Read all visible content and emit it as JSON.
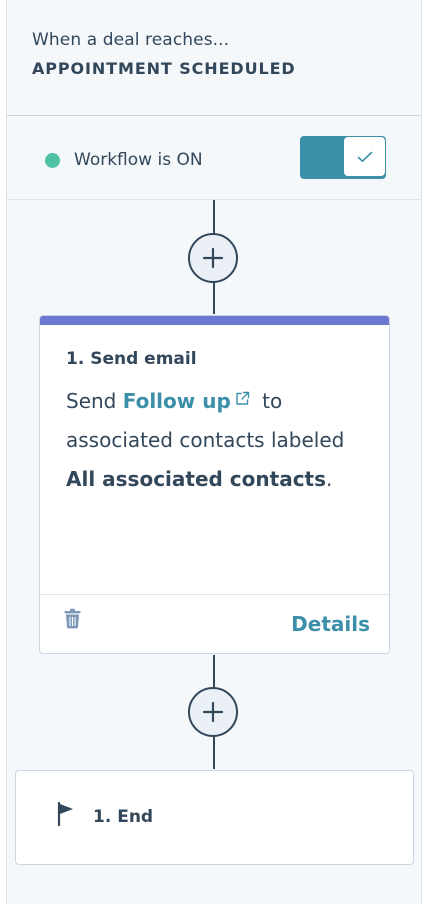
{
  "trigger": {
    "label": "When a deal reaches...",
    "stage": "APPOINTMENT SCHEDULED"
  },
  "status": {
    "text": "Workflow is ON",
    "dot_color": "#4fc1a5",
    "toggle_on": true,
    "toggle_color": "#3b8fa8"
  },
  "action": {
    "title": "1. Send email",
    "body_prefix": "Send",
    "email_link": "Follow up",
    "body_mid": "to associated contacts labeled",
    "label_name": "All associated contacts",
    "body_suffix": ".",
    "accent_color": "#6a78d1",
    "details_label": "Details",
    "delete_icon": "trash-icon",
    "link_icon": "external-link-icon"
  },
  "end": {
    "label": "1. End",
    "icon": "flag-icon"
  },
  "add_icon": "plus-icon"
}
